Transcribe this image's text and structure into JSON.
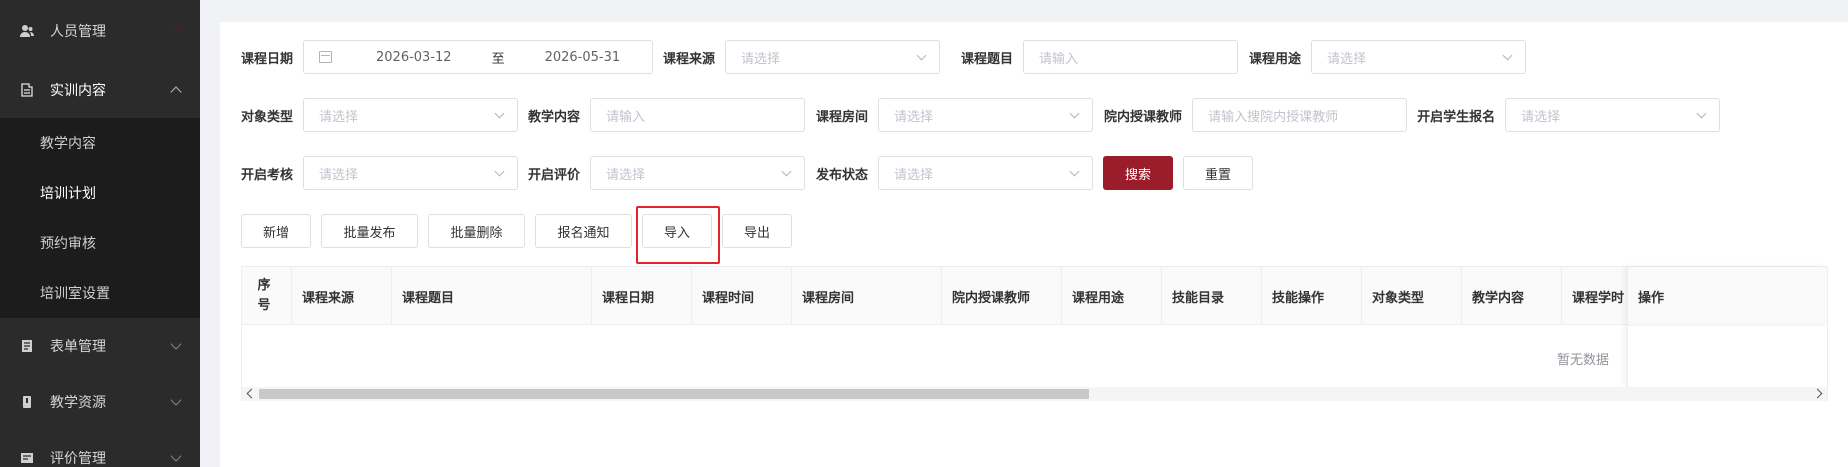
{
  "sidebar": {
    "items": [
      {
        "label": "人员管理",
        "icon": "users-icon"
      },
      {
        "label": "实训内容",
        "icon": "document-icon",
        "open": true
      },
      {
        "label": "表单管理",
        "icon": "form-icon"
      },
      {
        "label": "教学资源",
        "icon": "book-icon"
      },
      {
        "label": "评价管理",
        "icon": "evaluation-icon"
      }
    ],
    "sub_items": [
      {
        "label": "教学内容"
      },
      {
        "label": "培训计划",
        "active": true
      },
      {
        "label": "预约审核"
      },
      {
        "label": "培训室设置"
      }
    ]
  },
  "filters": {
    "course_date_label": "课程日期",
    "date_start": "2026-03-12",
    "date_sep": "至",
    "date_end": "2026-05-31",
    "course_source_label": "课程来源",
    "course_source_placeholder": "请选择",
    "course_title_label": "课程题目",
    "course_title_placeholder": "请输入",
    "course_use_label": "课程用途",
    "course_use_placeholder": "请选择",
    "target_type_label": "对象类型",
    "target_type_placeholder": "请选择",
    "teach_content_label": "教学内容",
    "teach_content_placeholder": "请输入",
    "course_room_label": "课程房间",
    "course_room_placeholder": "请选择",
    "teacher_label": "院内授课教师",
    "teacher_placeholder": "请输入搜院内授课教师",
    "student_enroll_label": "开启学生报名",
    "student_enroll_placeholder": "请选择",
    "exam_label": "开启考核",
    "exam_placeholder": "请选择",
    "evaluation_label": "开启评价",
    "evaluation_placeholder": "请选择",
    "publish_status_label": "发布状态",
    "publish_status_placeholder": "请选择",
    "search_button": "搜索",
    "reset_button": "重置"
  },
  "toolbar": {
    "add": "新增",
    "batch_publish": "批量发布",
    "batch_delete": "批量删除",
    "enroll_notify": "报名通知",
    "import": "导入",
    "export": "导出"
  },
  "table": {
    "columns": [
      "序号",
      "课程来源",
      "课程题目",
      "课程日期",
      "课程时间",
      "课程房间",
      "院内授课教师",
      "课程用途",
      "技能目录",
      "技能操作",
      "对象类型",
      "教学内容",
      "课程学时"
    ],
    "action_column": "操作",
    "empty_text": "暂无数据"
  },
  "colors": {
    "sidebar_bg": "#2b2b2b",
    "submenu_bg": "#1c1c1c",
    "primary": "#9b1d2b",
    "highlight": "#e3232c"
  }
}
